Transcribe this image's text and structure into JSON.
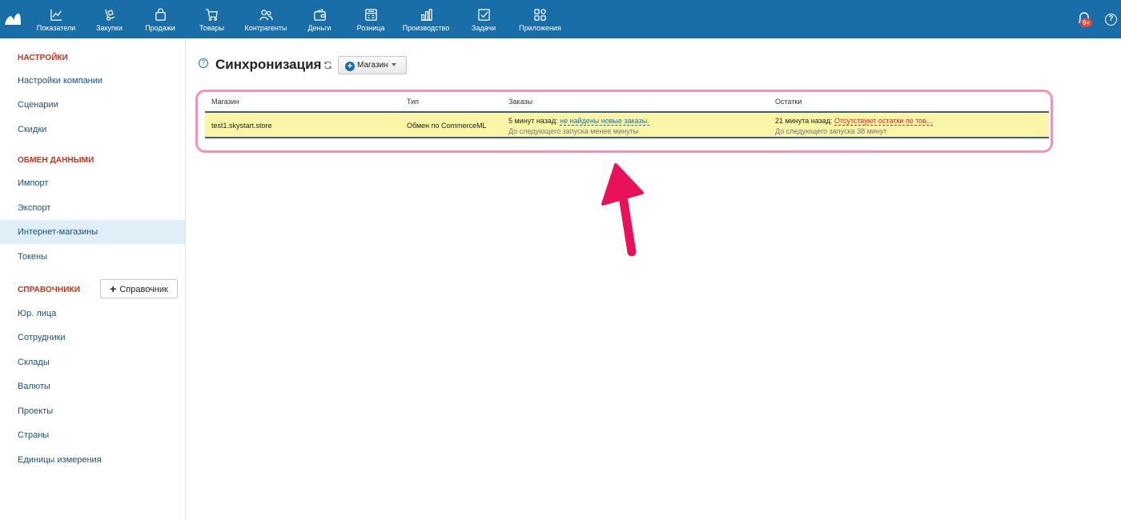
{
  "nav": {
    "items": [
      {
        "label": "Показатели",
        "icon": "chart-line-icon"
      },
      {
        "label": "Закупки",
        "icon": "dolly-icon"
      },
      {
        "label": "Продажи",
        "icon": "shopping-bag-icon"
      },
      {
        "label": "Товары",
        "icon": "cart-icon"
      },
      {
        "label": "Контрагенты",
        "icon": "people-icon"
      },
      {
        "label": "Деньги",
        "icon": "wallet-icon"
      },
      {
        "label": "Розница",
        "icon": "cash-register-icon"
      },
      {
        "label": "Производство",
        "icon": "bar-chart-icon"
      },
      {
        "label": "Задачи",
        "icon": "checkbox-icon"
      },
      {
        "label": "Приложения",
        "icon": "apps-grid-icon"
      }
    ],
    "badge": "9+",
    "help": "?"
  },
  "sidebar": {
    "sections": {
      "settings": "НАСТРОЙКИ",
      "exchange": "ОБМЕН ДАННЫМИ",
      "references": "СПРАВОЧНИКИ"
    },
    "settings_items": [
      "Настройки компании",
      "Сценарии",
      "Скидки"
    ],
    "exchange_items": [
      "Импорт",
      "Экспорт",
      "Интернет-магазины",
      "Токены"
    ],
    "reference_items": [
      "Юр. лица",
      "Сотрудники",
      "Склады",
      "Валюты",
      "Проекты",
      "Страны",
      "Единицы измерения"
    ],
    "add_reference_label": "Справочник"
  },
  "page": {
    "help": "?",
    "title": "Синхронизация",
    "add_shop_label": "Магазин"
  },
  "table": {
    "headers": [
      "Магазин",
      "Тип",
      "Заказы",
      "Остатки"
    ],
    "row": {
      "shop": "test1.skystart.store",
      "type": "Обмен по CommerceML",
      "orders_time": "5 минут назад:",
      "orders_status": "не найдены новые заказы.",
      "orders_next": "До следующего запуска менее минуты",
      "stock_time": "21 минута назад:",
      "stock_status": "Отсутствуют остатки по тов...",
      "stock_next": "До следующего запуска 38 минут"
    }
  },
  "colors": {
    "topbar": "#1a6ea8",
    "section_header": "#c6331f",
    "row_highlight": "#fbf6a7",
    "annotation": "#e8115a"
  }
}
